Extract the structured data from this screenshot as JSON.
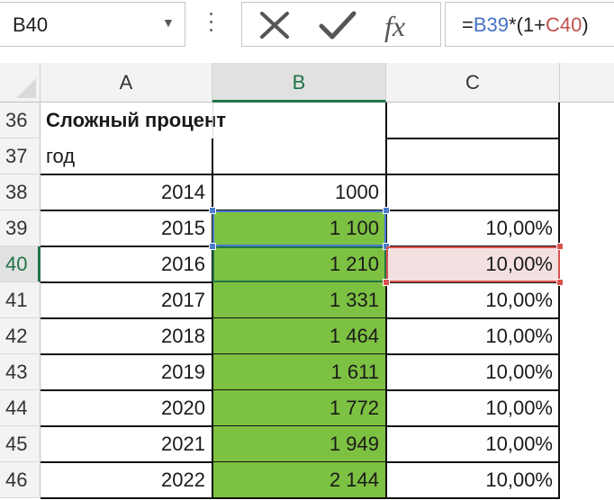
{
  "formula_bar": {
    "name_box": "B40",
    "name_box_dropdown_icon": "triangle-down-icon",
    "cancel_icon": "x-mark-icon",
    "enter_icon": "check-mark-icon",
    "fx_label": "fx",
    "formula_parts": [
      "=",
      "B39",
      "*(1+",
      "C40",
      ")"
    ]
  },
  "columns": [
    "A",
    "B",
    "C"
  ],
  "active_column": "B",
  "active_row": "40",
  "rows": [
    {
      "num": "36",
      "a": "Сложный процент",
      "b": "",
      "c": ""
    },
    {
      "num": "37",
      "a": "год",
      "b": "",
      "c": ""
    },
    {
      "num": "38",
      "a": "2014",
      "b": "1000",
      "c": ""
    },
    {
      "num": "39",
      "a": "2015",
      "b": "1 100",
      "c": "10,00%"
    },
    {
      "num": "40",
      "a": "2016",
      "b": "1 210",
      "c": "10,00%"
    },
    {
      "num": "41",
      "a": "2017",
      "b": "1 331",
      "c": "10,00%"
    },
    {
      "num": "42",
      "a": "2018",
      "b": "1 464",
      "c": "10,00%"
    },
    {
      "num": "43",
      "a": "2019",
      "b": "1 611",
      "c": "10,00%"
    },
    {
      "num": "44",
      "a": "2020",
      "b": "1 772",
      "c": "10,00%"
    },
    {
      "num": "45",
      "a": "2021",
      "b": "1 949",
      "c": "10,00%"
    },
    {
      "num": "46",
      "a": "2022",
      "b": "2 144",
      "c": "10,00%"
    }
  ],
  "colors": {
    "fill_green": "#7dc142",
    "ref_blue": "#4472c4",
    "ref_red": "#c0504d",
    "excel_green": "#217346"
  }
}
